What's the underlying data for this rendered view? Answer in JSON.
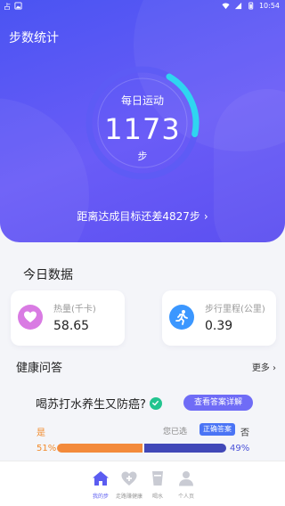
{
  "statusbar": {
    "left_text": "占",
    "time": "10:54"
  },
  "hero": {
    "title": "步数统计",
    "ring_label": "每日运动",
    "steps": "1173",
    "unit": "步",
    "remaining_text": "距离达成目标还差4827步",
    "progress_fraction": 0.2
  },
  "today": {
    "title": "今日数据",
    "calories": {
      "label": "热量(千卡)",
      "value": "58.65",
      "icon": "heart-icon"
    },
    "distance": {
      "label": "步行里程(公里)",
      "value": "0.39",
      "icon": "runner-icon"
    }
  },
  "health": {
    "title": "健康问答",
    "more": "更多",
    "question": "喝苏打水养生又防癌?",
    "answer_button": "查看答案详解",
    "yes": "是",
    "done": "您已选",
    "correct": "正确答案",
    "no": "否",
    "yes_pct": "51%",
    "no_pct": "49%",
    "yes_value": 51,
    "no_value": 49
  },
  "nav": {
    "items": [
      {
        "label": "我的步",
        "icon": "home-icon"
      },
      {
        "label": "走路赚健康",
        "icon": "health-plus-icon"
      },
      {
        "label": "喝水",
        "icon": "water-cup-icon"
      },
      {
        "label": "个人页",
        "icon": "person-icon"
      }
    ]
  },
  "colors": {
    "hero_gradient_start": "#4a54f2",
    "hero_gradient_end": "#5b4ff0",
    "ring_track": "#5d5cf4",
    "ring_progress": "#2fd5f0",
    "yes_color": "#f38a3b",
    "no_color": "#4148b8",
    "accent": "#6f6cf6"
  }
}
